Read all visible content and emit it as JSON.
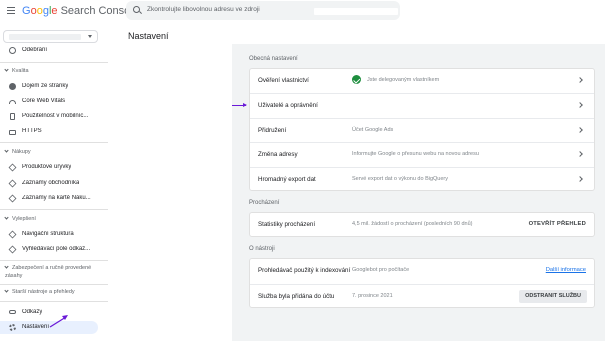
{
  "app": {
    "brand_google": "Google",
    "brand_product": "Search Console"
  },
  "search": {
    "placeholder": "Zkontrolujte libovolnou adresu ve zdroji"
  },
  "sidebar": {
    "top_item": "Odebrání",
    "sections": [
      {
        "label": "Kvalita",
        "items": [
          "Dojem ze stránky",
          "Core Web Vitals",
          "Použitelnost v mobilníc...",
          "HTTPS"
        ]
      },
      {
        "label": "Nákupy",
        "items": [
          "Produktové úryvky",
          "Záznamy obchodníka",
          "Záznamy na kartě Náku..."
        ]
      },
      {
        "label": "Vylepšení",
        "items": [
          "Navigační struktura",
          "Vyhledávací pole odkaz..."
        ]
      },
      {
        "label": "Zabezpečení a ručně provedené zásahy",
        "items": []
      },
      {
        "label": "Starší nástroje a přehledy",
        "items": []
      }
    ],
    "bottom_items": [
      "Odkazy",
      "Nastavení"
    ],
    "active_item": "Nastavení"
  },
  "main": {
    "title": "Nastavení",
    "general": {
      "label": "Obecná nastavení",
      "rows": [
        {
          "title": "Ověření vlastnictví",
          "value": "Jste delegovaným vlastníkem"
        },
        {
          "title": "Uživatelé a oprávnění",
          "value": ""
        },
        {
          "title": "Přidružení",
          "value": "Účet Google Ads"
        },
        {
          "title": "Změna adresy",
          "value": "Informujte Google o přesunu webu na novou adresu"
        },
        {
          "title": "Hromadný export dat",
          "value": "Servé export dat o výkonu do BigQuery"
        }
      ]
    },
    "crawling": {
      "label": "Procházení",
      "row": {
        "title": "Statistiky procházení",
        "value": "4,5 mil. žádostí o procházení (posledních 90 dnů)",
        "action": "OTEVŘÍT PŘEHLED"
      }
    },
    "about": {
      "label": "O nástroji",
      "rows": [
        {
          "title": "Prohledávač použitý k indexování",
          "value": "Googlebot pro počítače",
          "action": "Další informace"
        },
        {
          "title": "Služba byla přidána do účtu",
          "value": "7. prosince 2021",
          "action": "ODSTRANIT SLUŽBU"
        }
      ]
    }
  },
  "colors": {
    "accent_blue": "#1a73e8",
    "success_green": "#1e8e3e",
    "annotation_purple": "#6a1ad8",
    "active_bg": "#e8f0fe"
  }
}
